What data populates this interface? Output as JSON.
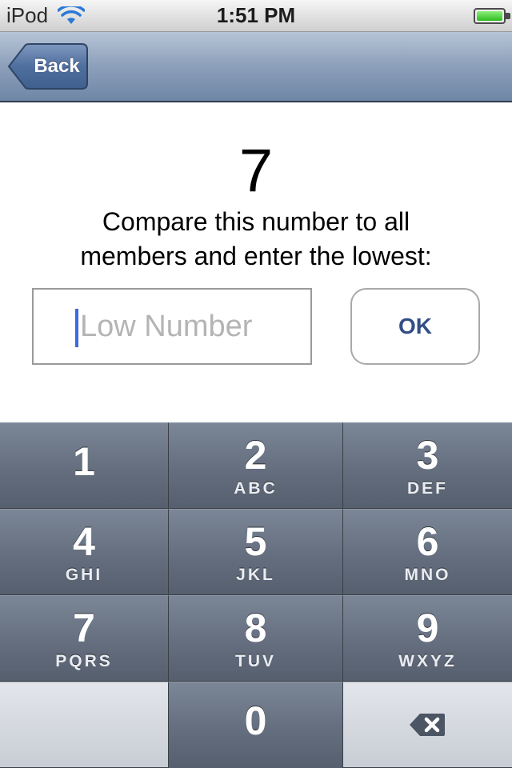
{
  "status_bar": {
    "carrier": "iPod",
    "time": "1:51 PM"
  },
  "nav_bar": {
    "back_label": "Back"
  },
  "content": {
    "number": "7",
    "prompt_line1": "Compare this number to all",
    "prompt_line2": "members and enter the lowest:",
    "input_placeholder": "Low Number",
    "input_value": "",
    "ok_label": "OK"
  },
  "keypad": {
    "keys": [
      {
        "digit": "1",
        "letters": ""
      },
      {
        "digit": "2",
        "letters": "ABC"
      },
      {
        "digit": "3",
        "letters": "DEF"
      },
      {
        "digit": "4",
        "letters": "GHI"
      },
      {
        "digit": "5",
        "letters": "JKL"
      },
      {
        "digit": "6",
        "letters": "MNO"
      },
      {
        "digit": "7",
        "letters": "PQRS"
      },
      {
        "digit": "8",
        "letters": "TUV"
      },
      {
        "digit": "9",
        "letters": "WXYZ"
      },
      {
        "digit": "0",
        "letters": ""
      }
    ],
    "delete_icon": "backspace-icon"
  },
  "colors": {
    "nav_bar": "#8c9fba",
    "ok_text": "#324f85",
    "caret": "#3d6adf",
    "key_face": "#646e7e",
    "battery": "#2dbb22"
  }
}
